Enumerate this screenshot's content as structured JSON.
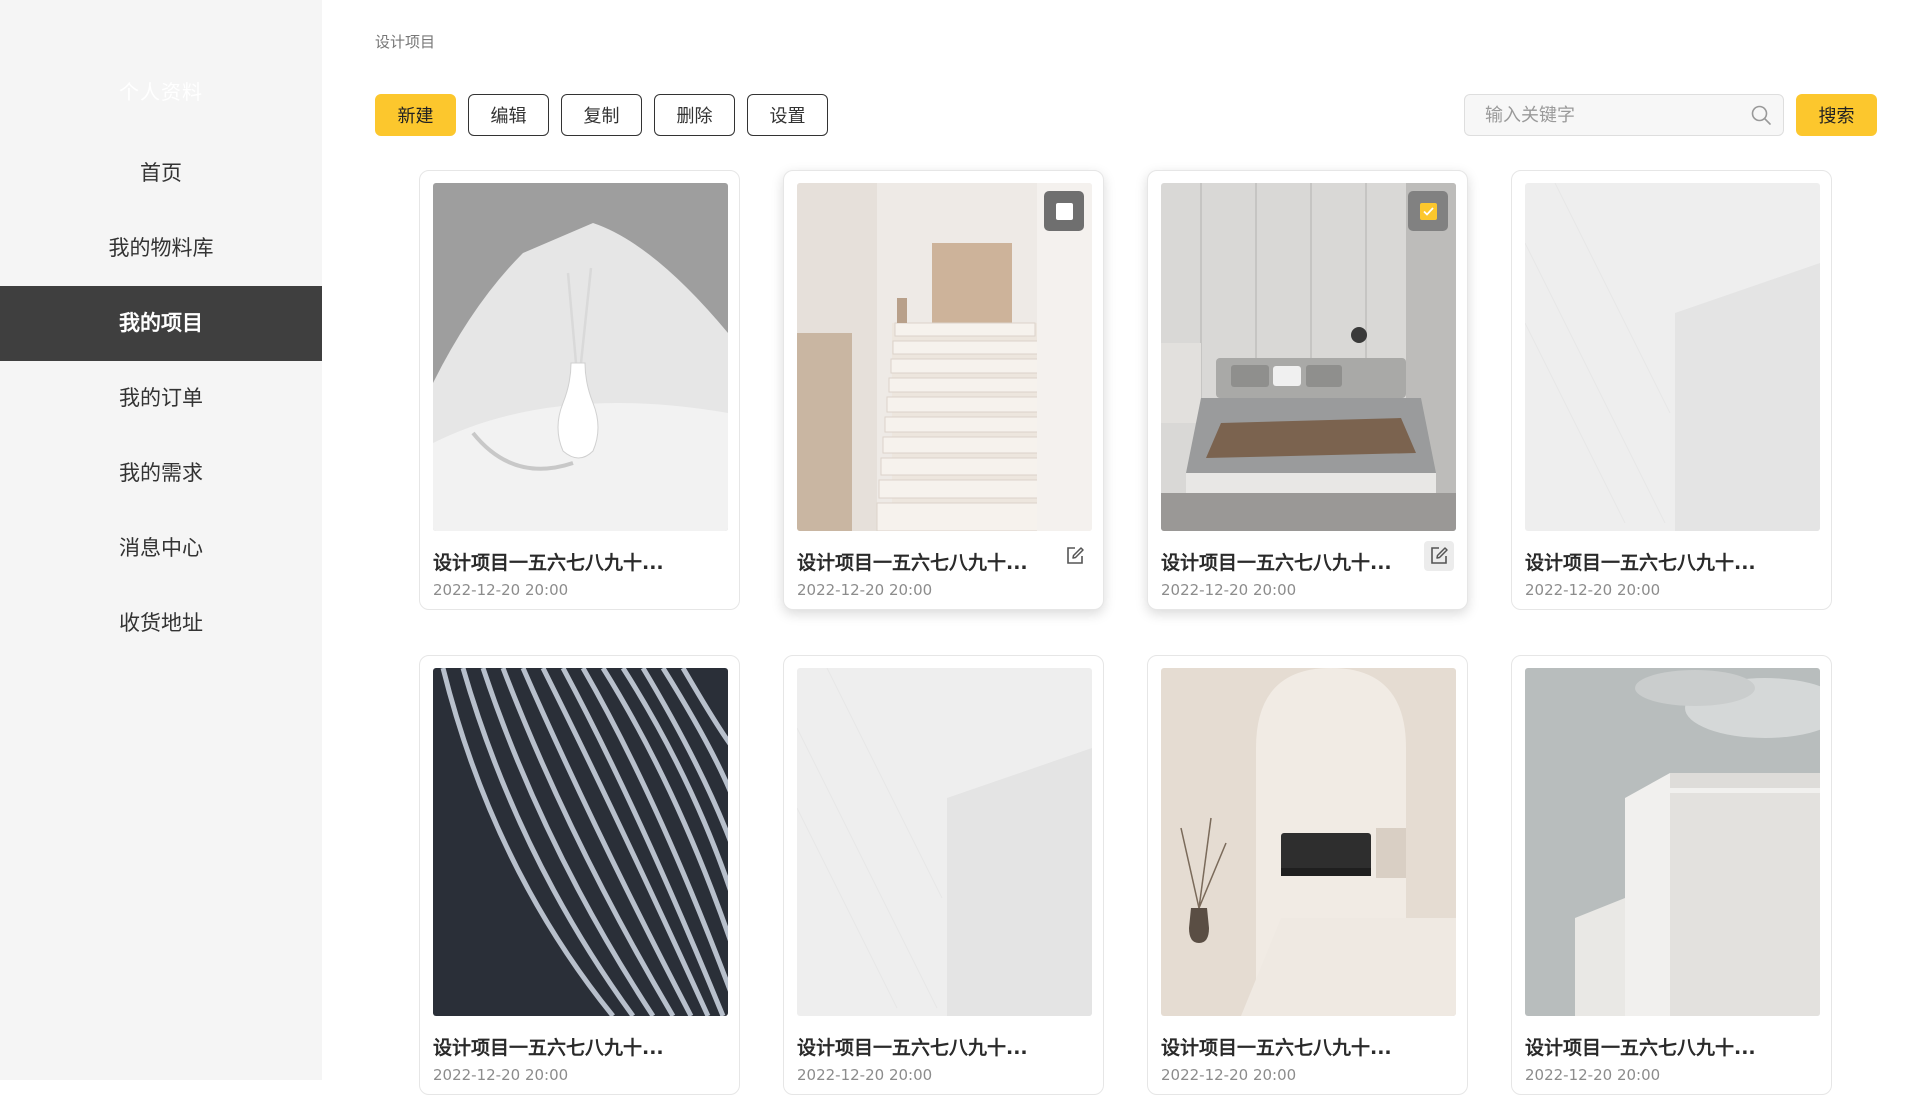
{
  "sidebar": {
    "profile_label": "个人资料",
    "items": [
      {
        "label": "首页"
      },
      {
        "label": "我的物料库"
      },
      {
        "label": "我的项目"
      },
      {
        "label": "我的订单"
      },
      {
        "label": "我的需求"
      },
      {
        "label": "消息中心"
      },
      {
        "label": "收货地址"
      }
    ],
    "active_index": 2
  },
  "breadcrumb": "设计项目",
  "toolbar": {
    "new_label": "新建",
    "edit_label": "编辑",
    "copy_label": "复制",
    "delete_label": "删除",
    "settings_label": "设置"
  },
  "search": {
    "placeholder": "输入关键字",
    "button_label": "搜索"
  },
  "colors": {
    "accent": "#fcc72d",
    "sidebar_bg": "#f5f5f5",
    "sidebar_active": "#3f3f3f"
  },
  "projects": [
    {
      "title": "设计项目一五六七八九十...",
      "date": "2022-12-20 20:00",
      "image": "vase-icon"
    },
    {
      "title": "设计项目一五六七八九十...",
      "date": "2022-12-20 20:00",
      "image": "stairs-icon",
      "selectable": true,
      "checked": false,
      "editable": true
    },
    {
      "title": "设计项目一五六七八九十...",
      "date": "2022-12-20 20:00",
      "image": "bedroom-icon",
      "selectable": true,
      "checked": true,
      "editable": true
    },
    {
      "title": "设计项目一五六七八九十...",
      "date": "2022-12-20 20:00",
      "image": "white-wall-icon"
    },
    {
      "title": "设计项目一五六七八九十...",
      "date": "2022-12-20 20:00",
      "image": "curved-lines-icon"
    },
    {
      "title": "设计项目一五六七八九十...",
      "date": "2022-12-20 20:00",
      "image": "white-wall-icon"
    },
    {
      "title": "设计项目一五六七八九十...",
      "date": "2022-12-20 20:00",
      "image": "arch-room-icon"
    },
    {
      "title": "设计项目一五六七八九十...",
      "date": "2022-12-20 20:00",
      "image": "white-building-icon"
    }
  ]
}
